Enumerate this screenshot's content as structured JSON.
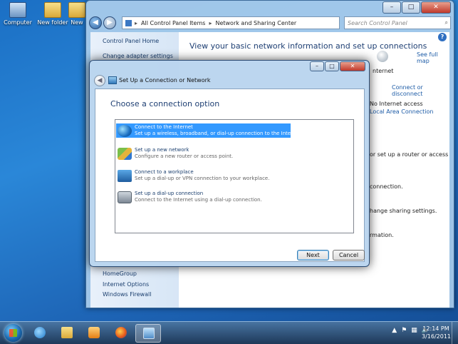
{
  "desktop": {
    "icons": [
      {
        "label": "Computer"
      },
      {
        "label": "New folder"
      },
      {
        "label": "New"
      }
    ]
  },
  "control_panel": {
    "breadcrumb": [
      "All Control Panel Items",
      "Network and Sharing Center"
    ],
    "search_placeholder": "Search Control Panel",
    "sidebar_links": [
      "Control Panel Home",
      "Change adapter settings",
      "HomeGroup",
      "Internet Options",
      "Windows Firewall"
    ],
    "main_title": "View your basic network information and set up connections",
    "see_full_map": "See full map",
    "internet_label": "nternet",
    "connect_or_disconnect": "Connect or disconnect",
    "no_internet_access": "No Internet access",
    "local_area_connection": "Local Area Connection",
    "partial_texts": [
      "or set up a router or access",
      "connection.",
      "hange sharing settings.",
      "rmation."
    ]
  },
  "dialog": {
    "title": "Set Up a Connection or Network",
    "heading": "Choose a connection option",
    "options": [
      {
        "title": "Connect to the Internet",
        "description": "Set up a wireless, broadband, or dial-up connection to the Internet.",
        "icon": "globe-icon",
        "selected": true
      },
      {
        "title": "Set up a new network",
        "description": "Configure a new router or access point.",
        "icon": "network-icon",
        "selected": false
      },
      {
        "title": "Connect to a workplace",
        "description": "Set up a dial-up or VPN connection to your workplace.",
        "icon": "workplace-icon",
        "selected": false
      },
      {
        "title": "Set up a dial-up connection",
        "description": "Connect to the Internet using a dial-up connection.",
        "icon": "dialup-icon",
        "selected": false
      }
    ],
    "next_label": "Next",
    "cancel_label": "Cancel"
  },
  "taskbar": {
    "time": "12:14 PM",
    "date": "3/16/2011",
    "items": [
      "ie-icon",
      "explorer-icon",
      "media-player-icon",
      "firefox-icon",
      "network-center-icon"
    ]
  },
  "colors": {
    "selection": "#3399ff",
    "link": "#1c5ba6",
    "heading": "#1e3f73"
  }
}
